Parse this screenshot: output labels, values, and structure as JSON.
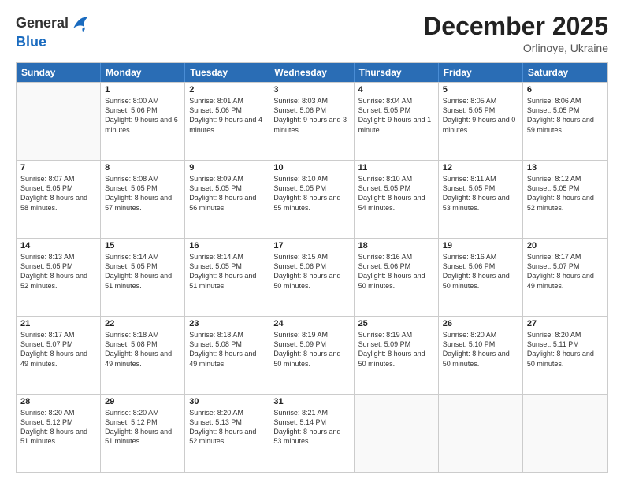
{
  "header": {
    "logo_general": "General",
    "logo_blue": "Blue",
    "month": "December 2025",
    "location": "Orlinoye, Ukraine"
  },
  "days_of_week": [
    "Sunday",
    "Monday",
    "Tuesday",
    "Wednesday",
    "Thursday",
    "Friday",
    "Saturday"
  ],
  "weeks": [
    [
      {
        "day": "",
        "sunrise": "",
        "sunset": "",
        "daylight": ""
      },
      {
        "day": "1",
        "sunrise": "Sunrise: 8:00 AM",
        "sunset": "Sunset: 5:06 PM",
        "daylight": "Daylight: 9 hours and 6 minutes."
      },
      {
        "day": "2",
        "sunrise": "Sunrise: 8:01 AM",
        "sunset": "Sunset: 5:06 PM",
        "daylight": "Daylight: 9 hours and 4 minutes."
      },
      {
        "day": "3",
        "sunrise": "Sunrise: 8:03 AM",
        "sunset": "Sunset: 5:06 PM",
        "daylight": "Daylight: 9 hours and 3 minutes."
      },
      {
        "day": "4",
        "sunrise": "Sunrise: 8:04 AM",
        "sunset": "Sunset: 5:05 PM",
        "daylight": "Daylight: 9 hours and 1 minute."
      },
      {
        "day": "5",
        "sunrise": "Sunrise: 8:05 AM",
        "sunset": "Sunset: 5:05 PM",
        "daylight": "Daylight: 9 hours and 0 minutes."
      },
      {
        "day": "6",
        "sunrise": "Sunrise: 8:06 AM",
        "sunset": "Sunset: 5:05 PM",
        "daylight": "Daylight: 8 hours and 59 minutes."
      }
    ],
    [
      {
        "day": "7",
        "sunrise": "Sunrise: 8:07 AM",
        "sunset": "Sunset: 5:05 PM",
        "daylight": "Daylight: 8 hours and 58 minutes."
      },
      {
        "day": "8",
        "sunrise": "Sunrise: 8:08 AM",
        "sunset": "Sunset: 5:05 PM",
        "daylight": "Daylight: 8 hours and 57 minutes."
      },
      {
        "day": "9",
        "sunrise": "Sunrise: 8:09 AM",
        "sunset": "Sunset: 5:05 PM",
        "daylight": "Daylight: 8 hours and 56 minutes."
      },
      {
        "day": "10",
        "sunrise": "Sunrise: 8:10 AM",
        "sunset": "Sunset: 5:05 PM",
        "daylight": "Daylight: 8 hours and 55 minutes."
      },
      {
        "day": "11",
        "sunrise": "Sunrise: 8:10 AM",
        "sunset": "Sunset: 5:05 PM",
        "daylight": "Daylight: 8 hours and 54 minutes."
      },
      {
        "day": "12",
        "sunrise": "Sunrise: 8:11 AM",
        "sunset": "Sunset: 5:05 PM",
        "daylight": "Daylight: 8 hours and 53 minutes."
      },
      {
        "day": "13",
        "sunrise": "Sunrise: 8:12 AM",
        "sunset": "Sunset: 5:05 PM",
        "daylight": "Daylight: 8 hours and 52 minutes."
      }
    ],
    [
      {
        "day": "14",
        "sunrise": "Sunrise: 8:13 AM",
        "sunset": "Sunset: 5:05 PM",
        "daylight": "Daylight: 8 hours and 52 minutes."
      },
      {
        "day": "15",
        "sunrise": "Sunrise: 8:14 AM",
        "sunset": "Sunset: 5:05 PM",
        "daylight": "Daylight: 8 hours and 51 minutes."
      },
      {
        "day": "16",
        "sunrise": "Sunrise: 8:14 AM",
        "sunset": "Sunset: 5:05 PM",
        "daylight": "Daylight: 8 hours and 51 minutes."
      },
      {
        "day": "17",
        "sunrise": "Sunrise: 8:15 AM",
        "sunset": "Sunset: 5:06 PM",
        "daylight": "Daylight: 8 hours and 50 minutes."
      },
      {
        "day": "18",
        "sunrise": "Sunrise: 8:16 AM",
        "sunset": "Sunset: 5:06 PM",
        "daylight": "Daylight: 8 hours and 50 minutes."
      },
      {
        "day": "19",
        "sunrise": "Sunrise: 8:16 AM",
        "sunset": "Sunset: 5:06 PM",
        "daylight": "Daylight: 8 hours and 50 minutes."
      },
      {
        "day": "20",
        "sunrise": "Sunrise: 8:17 AM",
        "sunset": "Sunset: 5:07 PM",
        "daylight": "Daylight: 8 hours and 49 minutes."
      }
    ],
    [
      {
        "day": "21",
        "sunrise": "Sunrise: 8:17 AM",
        "sunset": "Sunset: 5:07 PM",
        "daylight": "Daylight: 8 hours and 49 minutes."
      },
      {
        "day": "22",
        "sunrise": "Sunrise: 8:18 AM",
        "sunset": "Sunset: 5:08 PM",
        "daylight": "Daylight: 8 hours and 49 minutes."
      },
      {
        "day": "23",
        "sunrise": "Sunrise: 8:18 AM",
        "sunset": "Sunset: 5:08 PM",
        "daylight": "Daylight: 8 hours and 49 minutes."
      },
      {
        "day": "24",
        "sunrise": "Sunrise: 8:19 AM",
        "sunset": "Sunset: 5:09 PM",
        "daylight": "Daylight: 8 hours and 50 minutes."
      },
      {
        "day": "25",
        "sunrise": "Sunrise: 8:19 AM",
        "sunset": "Sunset: 5:09 PM",
        "daylight": "Daylight: 8 hours and 50 minutes."
      },
      {
        "day": "26",
        "sunrise": "Sunrise: 8:20 AM",
        "sunset": "Sunset: 5:10 PM",
        "daylight": "Daylight: 8 hours and 50 minutes."
      },
      {
        "day": "27",
        "sunrise": "Sunrise: 8:20 AM",
        "sunset": "Sunset: 5:11 PM",
        "daylight": "Daylight: 8 hours and 50 minutes."
      }
    ],
    [
      {
        "day": "28",
        "sunrise": "Sunrise: 8:20 AM",
        "sunset": "Sunset: 5:12 PM",
        "daylight": "Daylight: 8 hours and 51 minutes."
      },
      {
        "day": "29",
        "sunrise": "Sunrise: 8:20 AM",
        "sunset": "Sunset: 5:12 PM",
        "daylight": "Daylight: 8 hours and 51 minutes."
      },
      {
        "day": "30",
        "sunrise": "Sunrise: 8:20 AM",
        "sunset": "Sunset: 5:13 PM",
        "daylight": "Daylight: 8 hours and 52 minutes."
      },
      {
        "day": "31",
        "sunrise": "Sunrise: 8:21 AM",
        "sunset": "Sunset: 5:14 PM",
        "daylight": "Daylight: 8 hours and 53 minutes."
      },
      {
        "day": "",
        "sunrise": "",
        "sunset": "",
        "daylight": ""
      },
      {
        "day": "",
        "sunrise": "",
        "sunset": "",
        "daylight": ""
      },
      {
        "day": "",
        "sunrise": "",
        "sunset": "",
        "daylight": ""
      }
    ]
  ]
}
